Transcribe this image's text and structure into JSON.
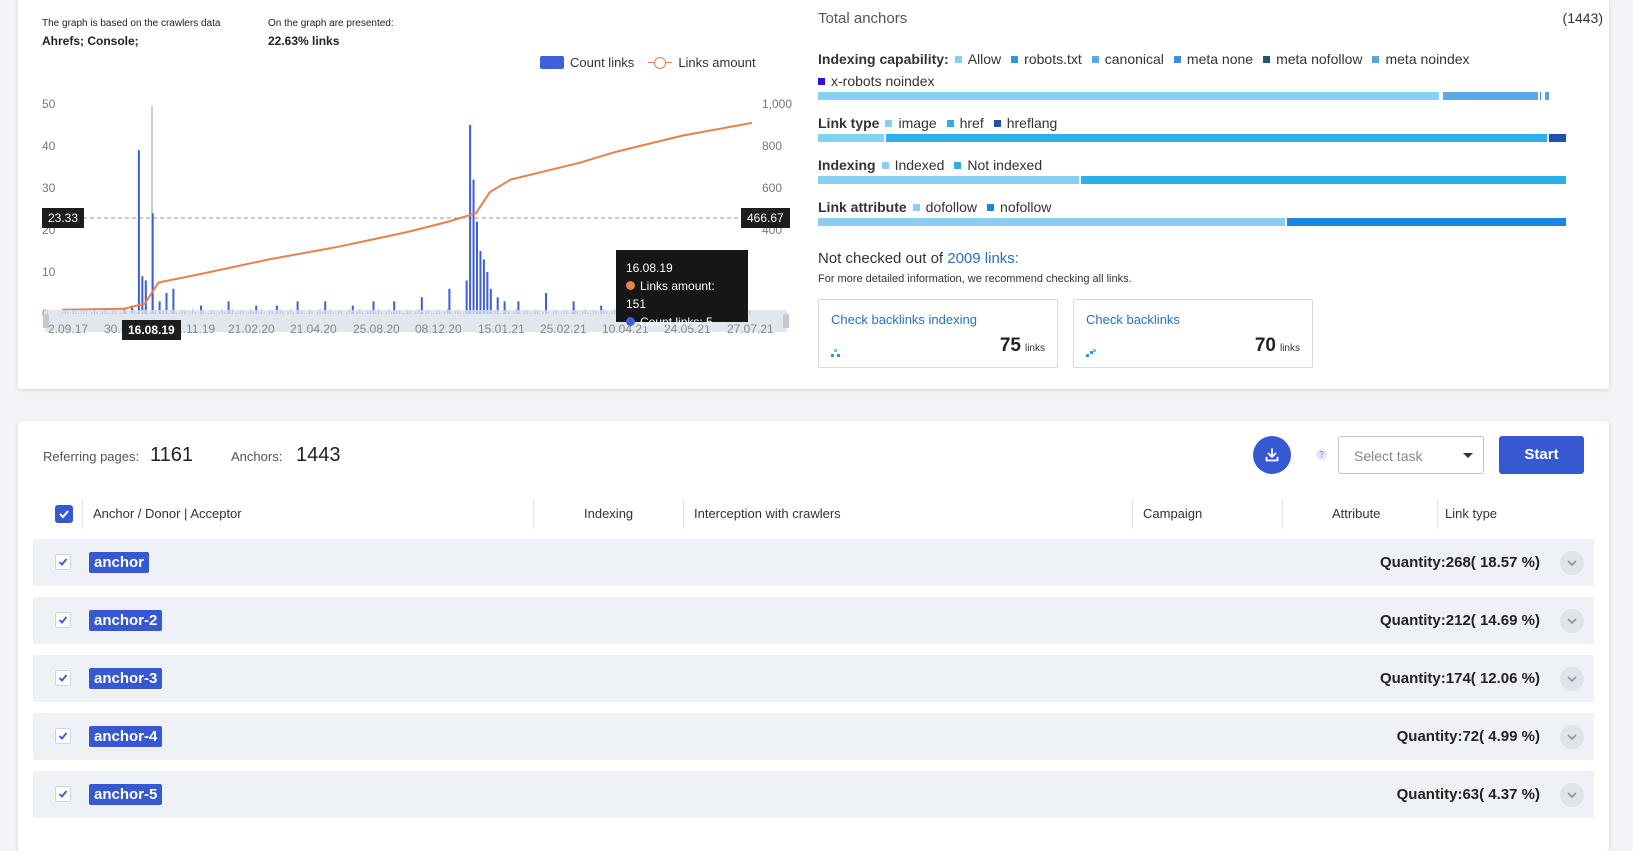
{
  "graph_info": {
    "crawler_label": "The graph is based on the crawlers data",
    "crawler_value": "Ahrefs; Console;",
    "presented_label": "On the graph are presented:",
    "presented_value": "22.63% links"
  },
  "legend": {
    "bars": "Count links",
    "line": "Links amount"
  },
  "chart_data": {
    "type": "bar+line",
    "x_tick_labels": [
      "2.09.17",
      "30...",
      "...11.19",
      "21.02.20",
      "21.04.20",
      "25.08.20",
      "08.12.20",
      "15.01.21",
      "25.02.21",
      "10.04.21",
      "24.05.21",
      "27.07.21"
    ],
    "y_left_ticks": [
      "0",
      "10",
      "20",
      "30",
      "40",
      "50"
    ],
    "y_right_ticks": [
      "400",
      "600",
      "800",
      "1,000"
    ],
    "y_left_range": [
      0,
      50
    ],
    "y_right_range": [
      0,
      1000
    ],
    "series": [
      {
        "name": "Count links",
        "kind": "bar",
        "color": "#3d5fd9",
        "x": [
          0.09,
          0.1,
          0.11,
          0.115,
          0.12,
          0.13,
          0.14,
          0.15,
          0.16,
          0.2,
          0.24,
          0.28,
          0.31,
          0.34,
          0.38,
          0.42,
          0.45,
          0.48,
          0.52,
          0.56,
          0.585,
          0.59,
          0.595,
          0.6,
          0.605,
          0.61,
          0.615,
          0.62,
          0.63,
          0.64,
          0.66,
          0.7,
          0.74,
          0.78,
          0.82
        ],
        "values": [
          1,
          2,
          39,
          9,
          8,
          24,
          3,
          5,
          6,
          2,
          3,
          2,
          2,
          3,
          3,
          2,
          3,
          3,
          4,
          6,
          8,
          45,
          32,
          22,
          15,
          13,
          10,
          6,
          4,
          3,
          3,
          5,
          3,
          2,
          3
        ]
      },
      {
        "name": "Links amount",
        "kind": "line",
        "color": "#e8804a",
        "x": [
          0.0,
          0.09,
          0.12,
          0.14,
          0.2,
          0.3,
          0.4,
          0.5,
          0.56,
          0.6,
          0.62,
          0.65,
          0.7,
          0.75,
          0.8,
          0.85,
          0.9,
          0.95,
          1.0
        ],
        "values": [
          20,
          25,
          50,
          150,
          190,
          260,
          320,
          390,
          440,
          480,
          580,
          640,
          680,
          720,
          770,
          810,
          850,
          880,
          910
        ]
      }
    ],
    "crosshair": {
      "left_value": "23.33",
      "right_value": "466.67",
      "x_label": "16.08.19"
    },
    "tooltip": {
      "date": "16.08.19",
      "links_amount": "Links amount: 151",
      "count_links": "Count links: 5"
    }
  },
  "summary": {
    "total_anchors_label": "Total anchors",
    "total_anchors_value": "(1443)",
    "categories": [
      {
        "title": "Indexing capability:",
        "items": [
          {
            "label": "Allow",
            "color": "#86d1f3",
            "share": 0.83
          },
          {
            "label": "robots.txt",
            "color": "#2b9ad6",
            "share": 0.003
          },
          {
            "label": "canonical",
            "color": "#5ca9e6",
            "share": 0.13
          },
          {
            "label": "meta none",
            "color": "#3e8ee0",
            "share": 0.003
          },
          {
            "label": "meta nofollow",
            "color": "#1f5a66",
            "share": 0.003
          },
          {
            "label": "meta noindex",
            "color": "#55a6e0",
            "share": 0.008
          },
          {
            "label": "x-robots noindex",
            "color": "#2a14d6",
            "share": 0.003
          }
        ]
      },
      {
        "title": "Link type",
        "items": [
          {
            "label": "image",
            "color": "#86d1f3",
            "share": 0.09
          },
          {
            "label": "href",
            "color": "#2bb0e8",
            "share": 0.885
          },
          {
            "label": "hreflang",
            "color": "#1f4fb0",
            "share": 0.025
          }
        ]
      },
      {
        "title": "Indexing",
        "items": [
          {
            "label": "Indexed",
            "color": "#86d1f3",
            "share": 0.35
          },
          {
            "label": "Not indexed",
            "color": "#2bb0e8",
            "share": 0.65
          }
        ]
      },
      {
        "title": "Link attribute",
        "items": [
          {
            "label": "dofollow",
            "color": "#86d1f3",
            "share": 0.625
          },
          {
            "label": "nofollow",
            "color": "#1a86e0",
            "share": 0.375
          }
        ]
      }
    ],
    "not_checked_prefix": "Not checked out of",
    "not_checked_link": "2009 links:",
    "not_checked_sub": "For more detailed information, we recommend checking all links.",
    "check_indexing": {
      "label": "Check backlinks indexing",
      "value": "75",
      "unit": "links"
    },
    "check_backlinks": {
      "label": "Check backlinks",
      "value": "70",
      "unit": "links"
    }
  },
  "toolbar": {
    "referring_label": "Referring pages:",
    "referring_value": "1161",
    "anchors_label": "Anchors:",
    "anchors_value": "1443",
    "help": "?",
    "select_placeholder": "Select task",
    "start_label": "Start"
  },
  "table": {
    "headers": [
      "Anchor / Donor | Acceptor",
      "Indexing",
      "Interception with crawlers",
      "Campaign",
      "Attribute",
      "Link type"
    ],
    "rows": [
      {
        "anchor": "anchor",
        "quantity": "Quantity:268( 18.57 %)"
      },
      {
        "anchor": "anchor-2",
        "quantity": "Quantity:212( 14.69 %)"
      },
      {
        "anchor": "anchor-3",
        "quantity": "Quantity:174( 12.06 %)"
      },
      {
        "anchor": "anchor-4",
        "quantity": "Quantity:72( 4.99 %)"
      },
      {
        "anchor": "anchor-5",
        "quantity": "Quantity:63( 4.37 %)"
      }
    ]
  }
}
